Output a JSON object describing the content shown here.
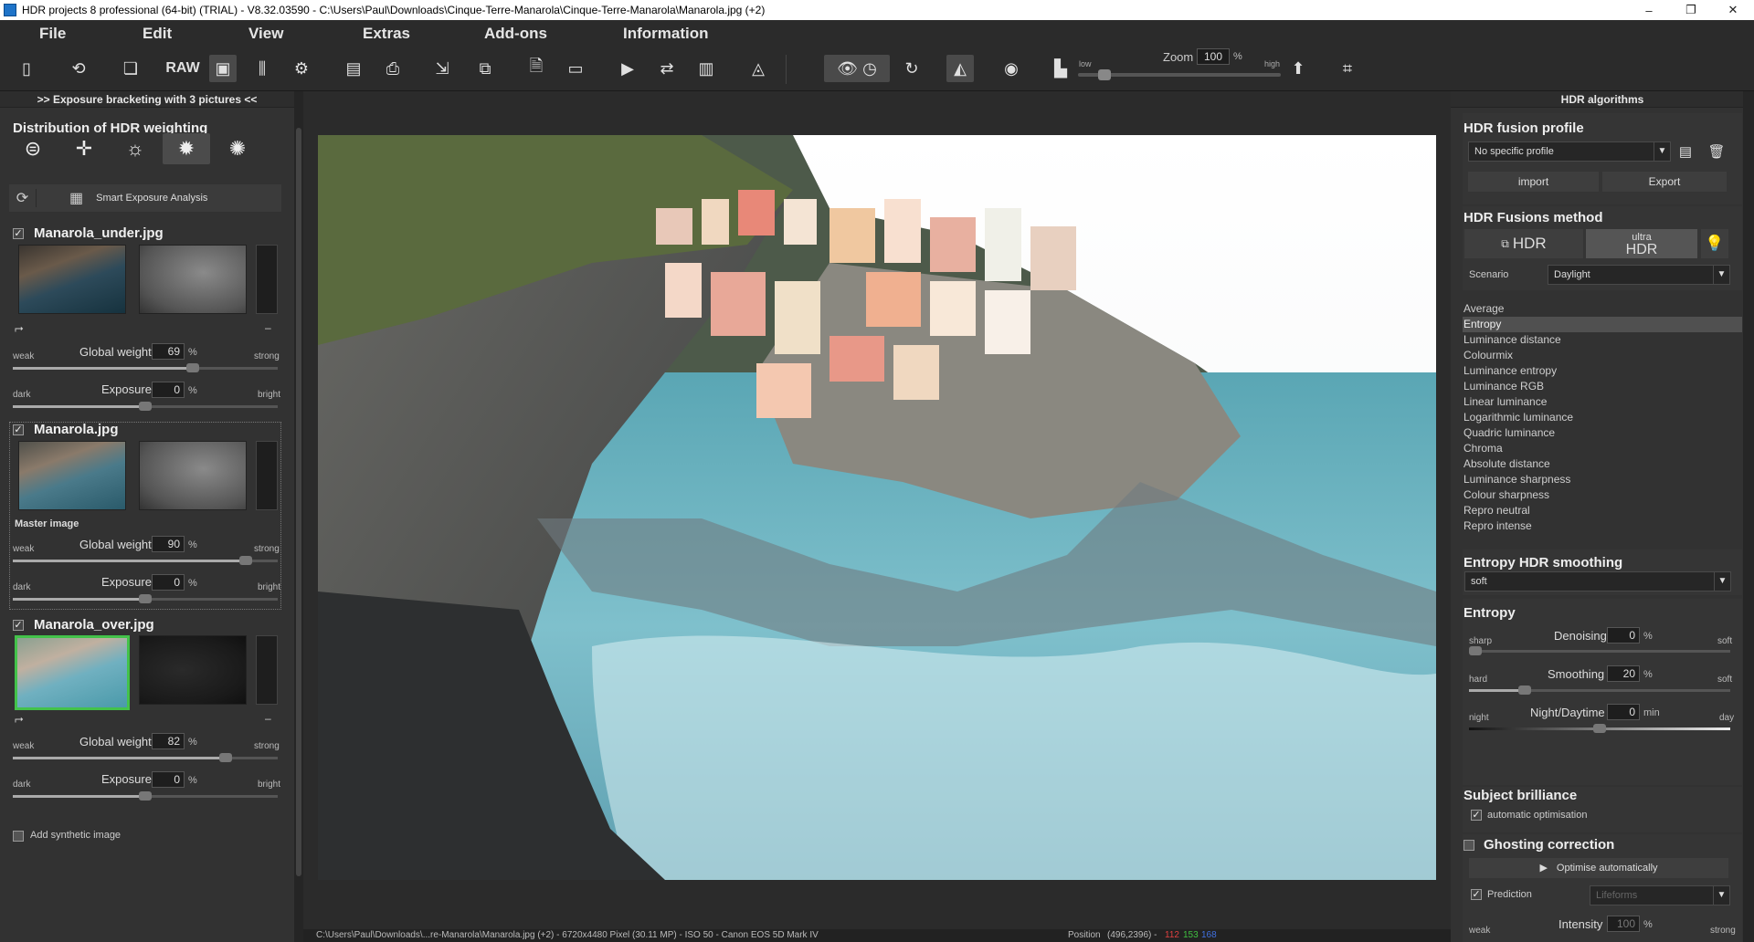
{
  "window": {
    "title": "HDR projects 8 professional (64-bit) (TRIAL) - V8.32.03590 - C:\\Users\\Paul\\Downloads\\Cinque-Terre-Manarola\\Cinque-Terre-Manarola\\Manarola.jpg (+2)",
    "minimize": "–",
    "maximize": "❐",
    "close": "✕"
  },
  "menu": [
    "File",
    "Edit",
    "View",
    "Extras",
    "Add-ons",
    "Information"
  ],
  "toolbar": {
    "raw_label": "RAW",
    "zoom_label": "Zoom",
    "zoom_value": "100",
    "zoom_unit": "%",
    "zoom_low": "low",
    "zoom_high": "high"
  },
  "left": {
    "header": ">> Exposure bracketing with 3 pictures <<",
    "dist_title": "Distribution of HDR weighting",
    "smart_label": "Smart Exposure Analysis",
    "images": [
      {
        "name": "Manarola_under.jpg",
        "global_weight": "69",
        "exposure": "0",
        "weight_fraction": 0.69,
        "exposure_fraction": 0.5
      },
      {
        "name": "Manarola.jpg",
        "master": "Master image",
        "global_weight": "90",
        "exposure": "0",
        "weight_fraction": 0.9,
        "exposure_fraction": 0.5
      },
      {
        "name": "Manarola_over.jpg",
        "global_weight": "82",
        "exposure": "0",
        "weight_fraction": 0.82,
        "exposure_fraction": 0.5
      }
    ],
    "global_weight_label": "Global weight",
    "exposure_label": "Exposure",
    "pct": "%",
    "weak": "weak",
    "strong": "strong",
    "dark": "dark",
    "bright": "bright",
    "add_synthetic": "Add synthetic image"
  },
  "status": {
    "path": "C:\\Users\\Paul\\Downloads\\...re-Manarola\\Manarola.jpg (+2) - 6720x4480 Pixel (30.11 MP) - ISO 50 - Canon EOS 5D Mark IV",
    "position_label": "Position",
    "position_value": "(496,2396) -",
    "r": "112",
    "g": "153",
    "b": "168"
  },
  "right": {
    "header": "HDR algorithms",
    "fusion_profile_title": "HDR fusion profile",
    "profile_value": "No specific profile",
    "import": "import",
    "export": "Export",
    "fusion_method_title": "HDR Fusions method",
    "hdr_btn": "HDR",
    "ultra_top": "ultra",
    "ultra_bottom": "HDR",
    "scenario_label": "Scenario",
    "scenario_value": "Daylight",
    "algorithms": [
      "Average",
      "Entropy",
      "Luminance distance",
      "Colourmix",
      "Luminance entropy",
      "Luminance RGB",
      "Linear luminance",
      "Logarithmic luminance",
      "Quadric luminance",
      "Chroma",
      "Absolute distance",
      "Luminance sharpness",
      "Colour sharpness",
      "Repro neutral",
      "Repro intense"
    ],
    "selected_algorithm": "Entropy",
    "smoothing_title": "Entropy HDR smoothing",
    "smoothing_value": "soft",
    "entropy_title": "Entropy",
    "denoising_label": "Denoising",
    "denoising_value": "0",
    "denoising_fraction": 0.0,
    "sharp": "sharp",
    "soft": "soft",
    "smoothing_label": "Smoothing",
    "smoothing_num": "20",
    "smoothing_fraction": 0.2,
    "hard": "hard",
    "night_label": "Night/Daytime",
    "night_value": "0",
    "night_unit": "min",
    "night_fraction": 0.5,
    "night": "night",
    "day": "day",
    "brilliance_title": "Subject brilliance",
    "auto_opt": "automatic optimisation",
    "ghosting_title": "Ghosting correction",
    "optimise_btn": "Optimise automatically",
    "prediction_label": "Prediction",
    "prediction_value": "Lifeforms",
    "intensity_label": "Intensity",
    "intensity_value": "100",
    "weak": "weak",
    "strong": "strong",
    "pct": "%"
  }
}
